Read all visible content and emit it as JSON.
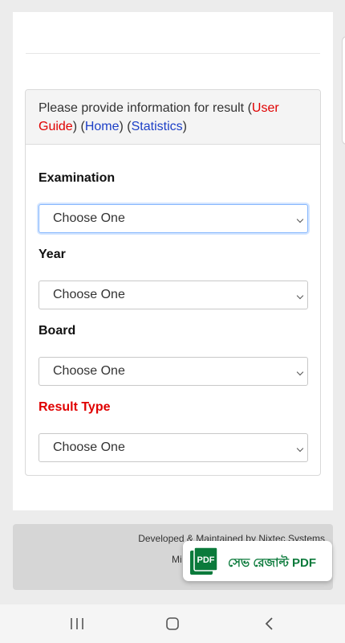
{
  "form": {
    "intro": "Please provide information for result (",
    "user_guide": "User Guide",
    "sep1": ") (",
    "home": "Home",
    "sep2": ") (",
    "statistics": "Statistics",
    "close": ")",
    "fields": [
      {
        "label": "Examination",
        "value": "Choose One"
      },
      {
        "label": "Year",
        "value": "Choose One"
      },
      {
        "label": "Board",
        "value": "Choose One"
      },
      {
        "label": "Result Type",
        "value": "Choose One"
      }
    ]
  },
  "footer": {
    "credit": "Developed & Maintained by Nixtec Systems",
    "second_line_partial": "Mi"
  },
  "pdf_button": {
    "icon_text": "PDF",
    "label": "সেভ রেজাল্ট PDF",
    "color": "#0b7a3b"
  },
  "navbar": {
    "icons": [
      "recent-apps-icon",
      "home-icon",
      "back-icon"
    ]
  },
  "colors": {
    "accent_red": "#e00000",
    "link_blue": "#1c3fc7",
    "pdf_green": "#0b7a3b"
  }
}
